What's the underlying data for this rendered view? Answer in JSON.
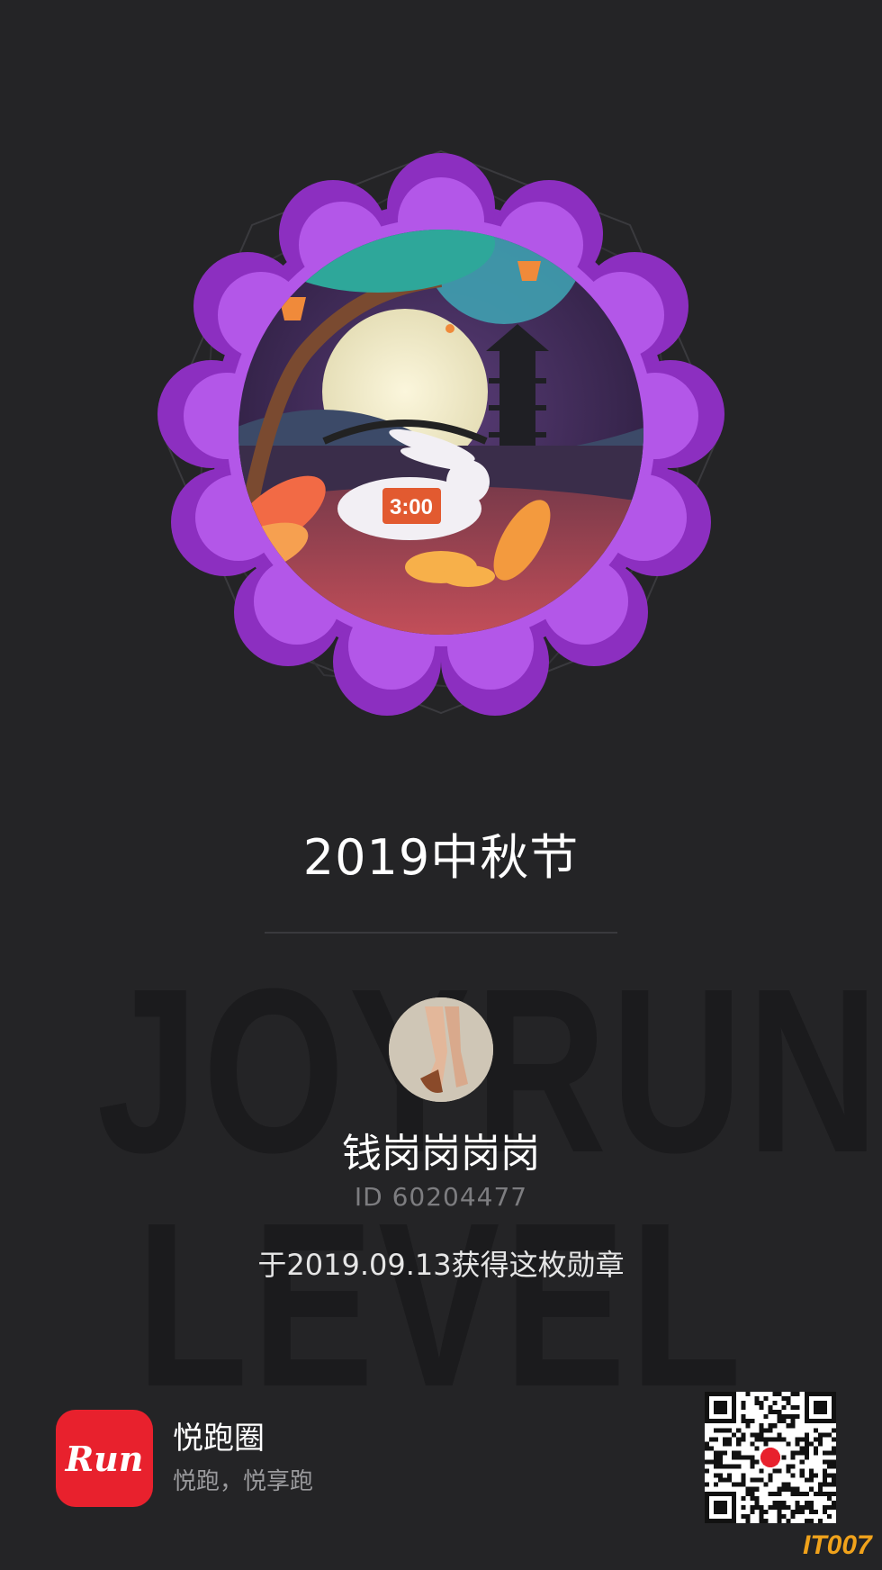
{
  "badge": {
    "time_label": "3:00"
  },
  "watermark": {
    "line1": "JOYRUN",
    "line2": "LEVEL"
  },
  "title": "2019中秋节",
  "user": {
    "name": "钱岗岗岗岗",
    "id_text": "ID 60204477"
  },
  "earned_text": "于2019.09.13获得这枚勋章",
  "app": {
    "logo_text": "Run",
    "name": "悦跑圈",
    "slogan": "悦跑，悦享跑"
  },
  "corner_logo": "IT007",
  "colors": {
    "background": "#242426",
    "badge_frame": "#9b3fd1",
    "app_red": "#e8212d",
    "corner_logo": "#f0a21b"
  }
}
